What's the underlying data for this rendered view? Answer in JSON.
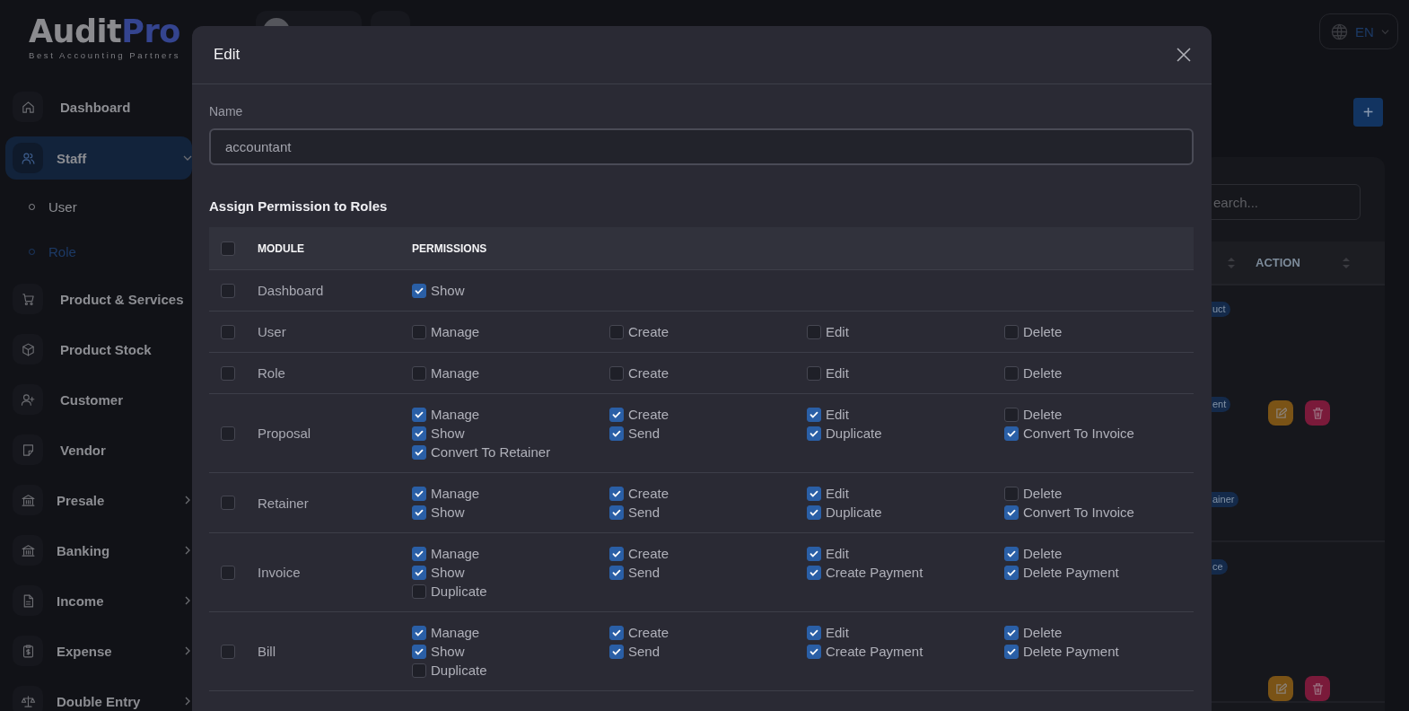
{
  "brand": {
    "name_main": "Audit",
    "name_accent": "Pro",
    "tagline": "Best Accounting Partners"
  },
  "sidebar": {
    "items": [
      {
        "label": "Dashboard",
        "kind": "link",
        "selected": false
      },
      {
        "label": "Staff",
        "kind": "group",
        "selected": true,
        "expanded": true,
        "children": [
          {
            "label": "User",
            "selected": false
          },
          {
            "label": "Role",
            "selected": true
          }
        ]
      },
      {
        "label": "Product & Services",
        "kind": "link",
        "selected": false
      },
      {
        "label": "Product Stock",
        "kind": "link",
        "selected": false
      },
      {
        "label": "Customer",
        "kind": "link",
        "selected": false
      },
      {
        "label": "Vendor",
        "kind": "link",
        "selected": false
      },
      {
        "label": "Presale",
        "kind": "group",
        "selected": false,
        "expanded": false
      },
      {
        "label": "Banking",
        "kind": "group",
        "selected": false,
        "expanded": false
      },
      {
        "label": "Income",
        "kind": "group",
        "selected": false,
        "expanded": false
      },
      {
        "label": "Expense",
        "kind": "group",
        "selected": false,
        "expanded": false
      },
      {
        "label": "Double Entry",
        "kind": "group",
        "selected": false,
        "expanded": false
      }
    ]
  },
  "topbar": {
    "language": "EN"
  },
  "add_button": "+",
  "roles_table": {
    "search_placeholder": "earch...",
    "action_header": "ACTION",
    "rows": [
      {
        "badges": [
          "uct",
          "ent",
          "ainer"
        ]
      },
      {
        "badges": [
          "ce"
        ]
      }
    ]
  },
  "modal": {
    "title": "Edit",
    "name_label": "Name",
    "name_value": "accountant",
    "section_title": "Assign Permission to Roles",
    "table": {
      "columns": [
        "MODULE",
        "PERMISSIONS"
      ],
      "all_checked": false,
      "rows": [
        {
          "module": "Dashboard",
          "checked": false,
          "permissions": [
            {
              "label": "Show",
              "checked": true
            }
          ]
        },
        {
          "module": "User",
          "checked": false,
          "permissions": [
            {
              "label": "Manage",
              "checked": false
            },
            {
              "label": "Create",
              "checked": false
            },
            {
              "label": "Edit",
              "checked": false
            },
            {
              "label": "Delete",
              "checked": false
            }
          ]
        },
        {
          "module": "Role",
          "checked": false,
          "permissions": [
            {
              "label": "Manage",
              "checked": false
            },
            {
              "label": "Create",
              "checked": false
            },
            {
              "label": "Edit",
              "checked": false
            },
            {
              "label": "Delete",
              "checked": false
            }
          ]
        },
        {
          "module": "Proposal",
          "checked": false,
          "permissions": [
            {
              "label": "Manage",
              "checked": true
            },
            {
              "label": "Create",
              "checked": true
            },
            {
              "label": "Edit",
              "checked": true
            },
            {
              "label": "Delete",
              "checked": false
            },
            {
              "label": "Show",
              "checked": true
            },
            {
              "label": "Send",
              "checked": true
            },
            {
              "label": "Duplicate",
              "checked": true
            },
            {
              "label": "Convert To Invoice",
              "checked": true
            },
            {
              "label": "Convert To Retainer",
              "checked": true
            }
          ]
        },
        {
          "module": "Retainer",
          "checked": false,
          "permissions": [
            {
              "label": "Manage",
              "checked": true
            },
            {
              "label": "Create",
              "checked": true
            },
            {
              "label": "Edit",
              "checked": true
            },
            {
              "label": "Delete",
              "checked": false
            },
            {
              "label": "Show",
              "checked": true
            },
            {
              "label": "Send",
              "checked": true
            },
            {
              "label": "Duplicate",
              "checked": true
            },
            {
              "label": "Convert To Invoice",
              "checked": true
            }
          ]
        },
        {
          "module": "Invoice",
          "checked": false,
          "permissions": [
            {
              "label": "Manage",
              "checked": true
            },
            {
              "label": "Create",
              "checked": true
            },
            {
              "label": "Edit",
              "checked": true
            },
            {
              "label": "Delete",
              "checked": true
            },
            {
              "label": "Show",
              "checked": true
            },
            {
              "label": "Send",
              "checked": true
            },
            {
              "label": "Create Payment",
              "checked": true
            },
            {
              "label": "Delete Payment",
              "checked": true
            },
            {
              "label": "Duplicate",
              "checked": false
            }
          ]
        },
        {
          "module": "Bill",
          "checked": false,
          "permissions": [
            {
              "label": "Manage",
              "checked": true
            },
            {
              "label": "Create",
              "checked": true
            },
            {
              "label": "Edit",
              "checked": true
            },
            {
              "label": "Delete",
              "checked": true
            },
            {
              "label": "Show",
              "checked": true
            },
            {
              "label": "Send",
              "checked": true
            },
            {
              "label": "Create Payment",
              "checked": true
            },
            {
              "label": "Delete Payment",
              "checked": true
            },
            {
              "label": "Duplicate",
              "checked": false
            }
          ]
        }
      ]
    }
  }
}
